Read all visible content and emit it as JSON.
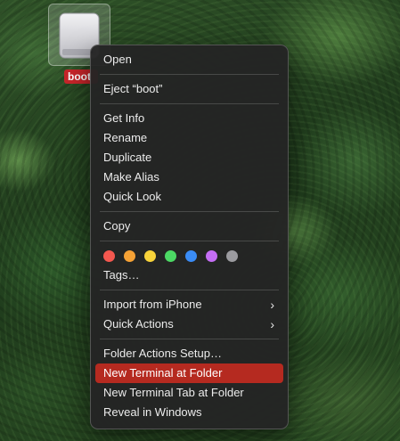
{
  "desktop": {
    "drive_label": "boot"
  },
  "menu": {
    "open": "Open",
    "eject": "Eject “boot”",
    "get_info": "Get Info",
    "rename": "Rename",
    "duplicate": "Duplicate",
    "make_alias": "Make Alias",
    "quick_look": "Quick Look",
    "copy": "Copy",
    "tag_colors": [
      "#f4584f",
      "#f6a235",
      "#f8d33a",
      "#4cd964",
      "#3a8cf6",
      "#c56ef5",
      "#9b9b9f"
    ],
    "tags": "Tags…",
    "import_from_iphone": "Import from iPhone",
    "quick_actions": "Quick Actions",
    "folder_actions_setup": "Folder Actions Setup…",
    "new_terminal_at_folder": "New Terminal at Folder",
    "new_terminal_tab_at_folder": "New Terminal Tab at Folder",
    "reveal_in_windows": "Reveal in Windows",
    "submenu_glyph": "›"
  },
  "colors": {
    "highlight": "#b52a20",
    "label_badge": "#c8252a"
  }
}
